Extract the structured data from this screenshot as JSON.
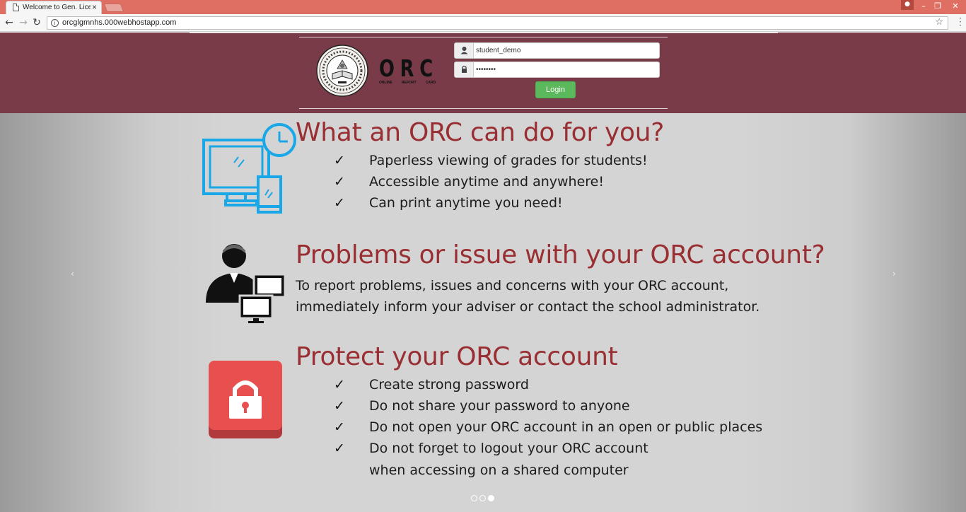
{
  "browser": {
    "tab_title": "Welcome to Gen. Licerio",
    "tab_close": "×",
    "url": "orcglgmnhs.000webhostapp.com",
    "window_controls": [
      "minimize",
      "restore",
      "close"
    ]
  },
  "header": {
    "logo_letters": "ORC",
    "logo_sub": [
      "ONLINE",
      "REPORT",
      "CARD"
    ],
    "username_value": "student_demo",
    "password_value": "••••••••",
    "login_label": "Login",
    "accent_color": "#7a3b49",
    "login_color": "#5cb85c"
  },
  "carousel": {
    "prev_label": "‹",
    "next_label": "›",
    "active_index": 3,
    "slide_count": 3,
    "section1": {
      "title": "What an ORC can do for you?",
      "items": [
        "Paperless viewing of grades for students!",
        "Accessible anytime and anywhere!",
        "Can print anytime you need!"
      ],
      "icon": "devices-icon"
    },
    "section2": {
      "title": "Problems or issue with your ORC account?",
      "lines": [
        "To report problems, issues and concerns with your ORC account,",
        "immediately inform your adviser or contact the school administrator."
      ],
      "icon": "admin-computer-icon"
    },
    "section3": {
      "title": "Protect your ORC account",
      "items": [
        "Create strong password",
        "Do not share your password to anyone",
        "Do not open your ORC account in an open or public places",
        "Do not forget to logout your ORC account"
      ],
      "item_continuation": "when accessing on a shared computer",
      "icon": "padlock-icon"
    },
    "check_mark": "✓",
    "heading_color": "#9a2f33"
  }
}
